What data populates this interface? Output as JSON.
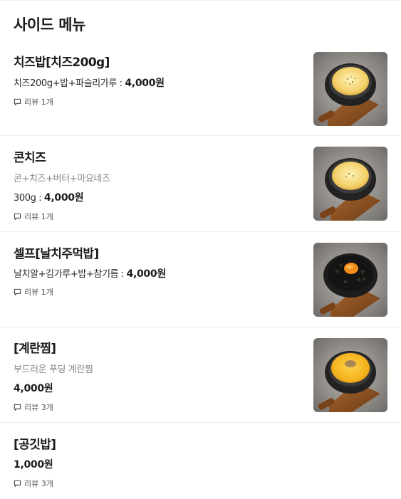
{
  "section": {
    "title": "사이드 메뉴"
  },
  "items": [
    {
      "name": "치즈밥[치즈200g]",
      "desc": "치즈200g+밥+파슬리가루 : ",
      "price": "4,000원",
      "review": "리뷰 1개",
      "image_icon": "cheese-rice-bowl"
    },
    {
      "name": "콘치즈",
      "desc": "콘+치즈+버터+마요네즈",
      "spec": "300g : ",
      "price": "4,000원",
      "review": "리뷰 1개",
      "image_icon": "corn-cheese-bowl"
    },
    {
      "name": "셀프[날치주먹밥]",
      "desc": "날치알+김가루+밥+참기름 : ",
      "price": "4,000원",
      "review": "리뷰 1개",
      "image_icon": "flying-fish-roe-rice-bowl"
    },
    {
      "name": "[계란찜]",
      "desc": "부드러운 푸딩 계란찜",
      "price": "4,000원",
      "review": "리뷰 3개",
      "image_icon": "steamed-egg-bowl"
    },
    {
      "name": "[공깃밥]",
      "price": "1,000원",
      "review": "리뷰 3개"
    }
  ]
}
